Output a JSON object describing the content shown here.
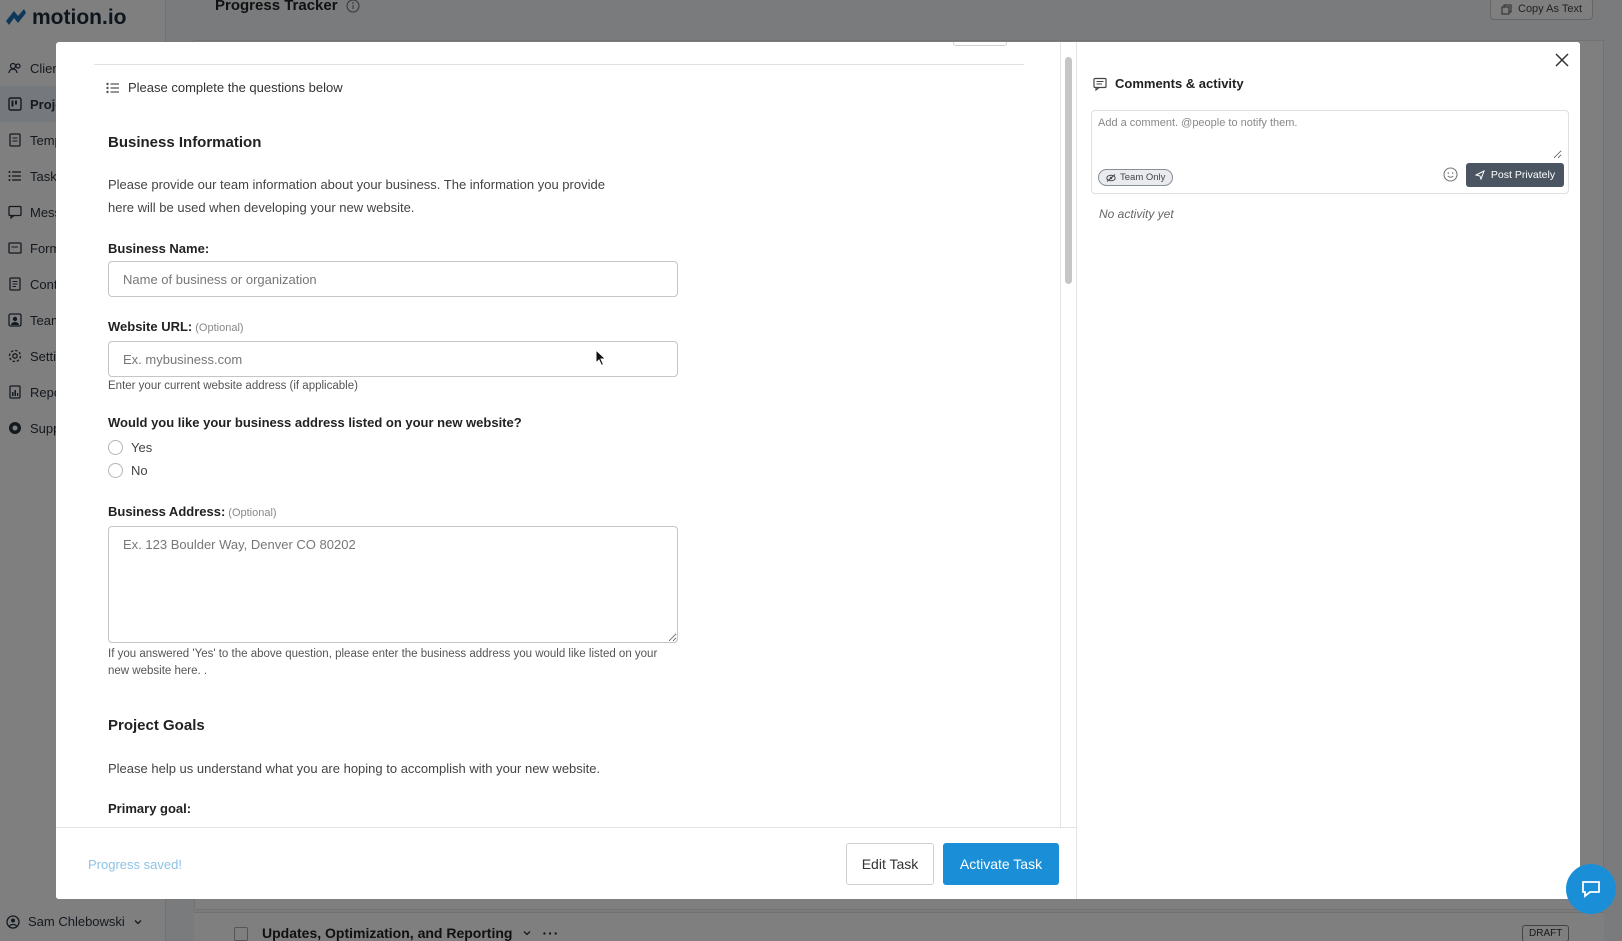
{
  "app": {
    "logo_text": "motion.io",
    "nav": [
      {
        "label": "Clien",
        "icon": "users-icon"
      },
      {
        "label": "Proje",
        "icon": "projects-icon",
        "active": true
      },
      {
        "label": "Temp",
        "icon": "template-icon"
      },
      {
        "label": "Tasks",
        "icon": "list-icon"
      },
      {
        "label": "Mess",
        "icon": "message-icon"
      },
      {
        "label": "Form",
        "icon": "form-icon"
      },
      {
        "label": "Cont",
        "icon": "contract-icon"
      },
      {
        "label": "Team",
        "icon": "team-icon"
      },
      {
        "label": "Setti",
        "icon": "gear-icon"
      },
      {
        "label": "Repo",
        "icon": "report-icon"
      },
      {
        "label": "Supp",
        "icon": "support-icon"
      }
    ],
    "user_name": "Sam Chlebowski",
    "page_title": "Progress Tracker",
    "copy_as_text": "Copy As Text",
    "bottom_row_title": "Updates, Optimization, and Reporting",
    "draft_badge": "DRAFT"
  },
  "form": {
    "header": "Please complete the questions below",
    "section_business": {
      "title": "Business Information",
      "description_line1": "Please provide our team information about your business. The information you provide",
      "description_line2": "here will be used when developing  your new website."
    },
    "business_name": {
      "label": "Business Name:",
      "placeholder": "Name of business or organization"
    },
    "website_url": {
      "label": "Website URL:",
      "optional": "(Optional)",
      "placeholder": "Ex. mybusiness.com",
      "help": "Enter your current website address (if applicable)"
    },
    "address_question": {
      "label": "Would you like your business address listed on your new website?",
      "options": [
        "Yes",
        "No"
      ]
    },
    "business_address": {
      "label": "Business Address:",
      "optional": "(Optional)",
      "placeholder": "Ex. 123 Boulder Way, Denver CO 80202",
      "help_line1": "If you answered 'Yes' to the above question, please enter the business address you would like listed on your",
      "help_line2": "new website here. ."
    },
    "section_goals": {
      "title": "Project Goals",
      "description": "Please help us understand what you are hoping to accomplish with your new website."
    },
    "primary_goal": {
      "label": "Primary goal:"
    }
  },
  "footer": {
    "status": "Progress saved!",
    "edit_label": "Edit Task",
    "activate_label": "Activate Task",
    "activate_color": "#1a8fd8"
  },
  "comments": {
    "title": "Comments & activity",
    "placeholder": "Add a comment. @people to notify them.",
    "visibility_badge": "Team Only",
    "post_label": "Post Privately",
    "empty_text": "No activity yet"
  }
}
